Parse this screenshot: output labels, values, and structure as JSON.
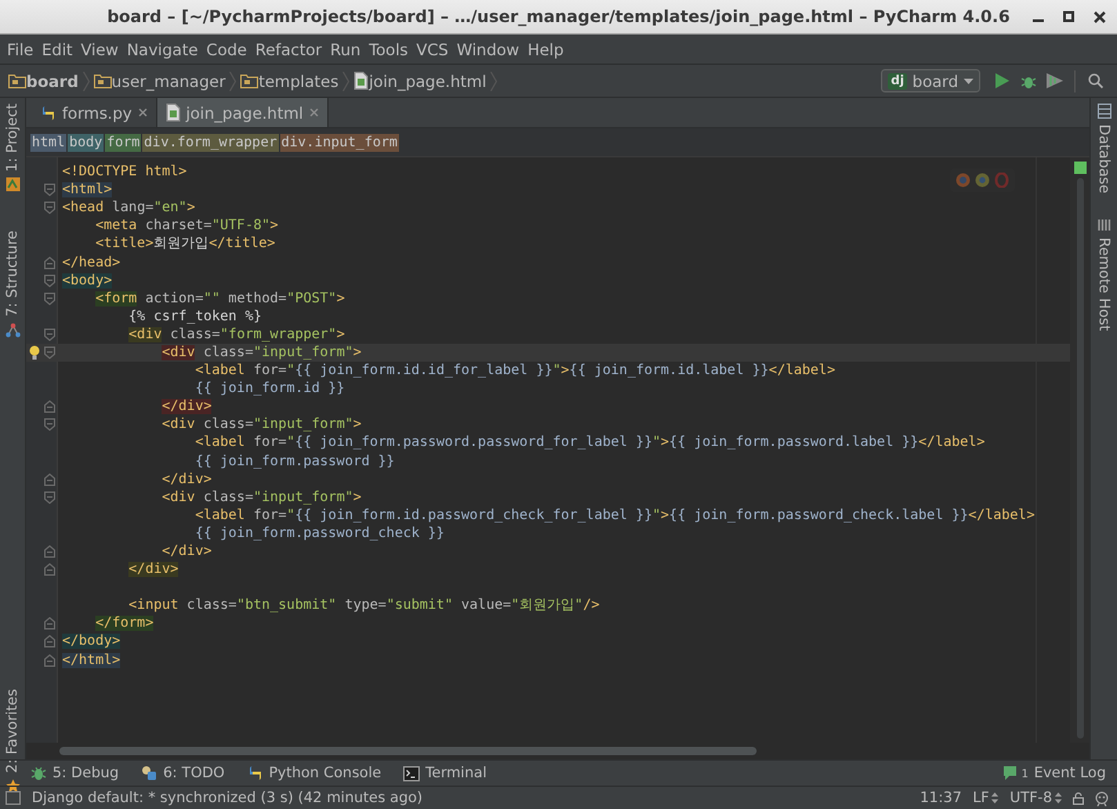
{
  "window": {
    "title": "board – [~/PycharmProjects/board] – …/user_manager/templates/join_page.html – PyCharm 4.0.6"
  },
  "menu": [
    "File",
    "Edit",
    "View",
    "Navigate",
    "Code",
    "Refactor",
    "Run",
    "Tools",
    "VCS",
    "Window",
    "Help"
  ],
  "nav": {
    "crumbs": [
      {
        "label": "board",
        "kind": "project"
      },
      {
        "label": "user_manager",
        "kind": "folder"
      },
      {
        "label": "templates",
        "kind": "folder"
      },
      {
        "label": "join_page.html",
        "kind": "file"
      }
    ],
    "run_config": {
      "badge": "dj",
      "label": "board"
    }
  },
  "left_tools": [
    {
      "label": "1: Project",
      "kind": "project"
    },
    {
      "label": "7: Structure",
      "kind": "structure"
    },
    {
      "label": "2: Favorites",
      "kind": "favorites"
    }
  ],
  "right_tools": [
    {
      "label": "Database",
      "kind": "database"
    },
    {
      "label": "Remote Host",
      "kind": "remote"
    }
  ],
  "tabs": [
    {
      "label": "forms.py",
      "kind": "python",
      "selected": false
    },
    {
      "label": "join_page.html",
      "kind": "html",
      "selected": true
    }
  ],
  "tag_path": [
    {
      "label": "html",
      "color": "#4b5a6b"
    },
    {
      "label": "body",
      "color": "#3f6367"
    },
    {
      "label": "form",
      "color": "#456a44"
    },
    {
      "label": "div.form_wrapper",
      "color": "#5d5b3f"
    },
    {
      "label": "div.input_form",
      "color": "#6b4e3b"
    }
  ],
  "code": {
    "lines": [
      {
        "current": false,
        "tokens": [
          {
            "kind": "tag",
            "t": "<!DOCTYPE html>"
          }
        ]
      },
      {
        "kind": "open",
        "current": false,
        "tokens": [
          {
            "kind": "tag",
            "t": "<html>",
            "color": "#2e3b48"
          }
        ]
      },
      {
        "kind": "open",
        "current": false,
        "tokens": [
          {
            "kind": "tag",
            "t": "<head"
          },
          {
            "kind": "attr",
            "t": " lang="
          },
          {
            "kind": "value",
            "t": "\"en\""
          },
          {
            "kind": "tag",
            "t": ">"
          }
        ],
        "children": [
          {
            "current": false,
            "tokens": [
              {
                "kind": "tag",
                "t": "<meta"
              },
              {
                "kind": "attr",
                "t": " charset="
              },
              {
                "kind": "value",
                "t": "\"UTF-8\""
              },
              {
                "kind": "tag",
                "t": ">"
              }
            ]
          },
          {
            "current": false,
            "tokens": [
              {
                "kind": "tag",
                "t": "<title>"
              },
              {
                "kind": "text",
                "t": "회원가입"
              },
              {
                "kind": "tag",
                "t": "</title>"
              }
            ]
          }
        ]
      },
      {
        "kind": "close",
        "current": false,
        "tokens": [
          {
            "kind": "tag",
            "t": "</head>"
          }
        ]
      },
      {
        "kind": "open",
        "current": false,
        "tokens": [
          {
            "kind": "tag",
            "t": "<body>",
            "color": "#1f3a3c"
          }
        ],
        "children": [
          {
            "kind": "open",
            "current": false,
            "tokens": [
              {
                "kind": "tag",
                "t": "<form",
                "color": "#2b3f22"
              },
              {
                "kind": "attr",
                "t": " action="
              },
              {
                "kind": "value",
                "t": "\"\""
              },
              {
                "kind": "attr",
                "t": " method="
              },
              {
                "kind": "value",
                "t": "\"POST\""
              },
              {
                "kind": "tag",
                "t": ">"
              }
            ],
            "children": [
              {
                "current": false,
                "tokens": [
                  {
                    "kind": "text",
                    "t": "{% csrf_token %}"
                  }
                ]
              },
              {
                "kind": "open",
                "current": false,
                "tokens": [
                  {
                    "kind": "tag",
                    "t": "<div",
                    "color": "#3a3a20"
                  },
                  {
                    "kind": "attr",
                    "t": " class="
                  },
                  {
                    "kind": "value",
                    "t": "\"form_wrapper\""
                  },
                  {
                    "kind": "tag",
                    "t": ">"
                  }
                ],
                "children": [
                  {
                    "kind": "open",
                    "current": true,
                    "tokens": [
                      {
                        "kind": "tag",
                        "t": "<div",
                        "color": "#4a2424"
                      },
                      {
                        "kind": "attr",
                        "t": " class="
                      },
                      {
                        "kind": "value",
                        "t": "\"input_form\""
                      },
                      {
                        "kind": "tag",
                        "t": ">"
                      }
                    ],
                    "children": [
                      {
                        "current": false,
                        "tokens": [
                          {
                            "kind": "tag",
                            "t": "<label"
                          },
                          {
                            "kind": "attr",
                            "t": " for="
                          },
                          {
                            "kind": "value",
                            "t": "\""
                          },
                          {
                            "kind": "tpl",
                            "t": "{{ join_form.id.id_for_label }}"
                          },
                          {
                            "kind": "value",
                            "t": "\""
                          },
                          {
                            "kind": "tag",
                            "t": ">"
                          },
                          {
                            "kind": "tpl",
                            "t": "{{ join_form.id.label }}"
                          },
                          {
                            "kind": "tag",
                            "t": "</label>"
                          }
                        ]
                      },
                      {
                        "current": false,
                        "tokens": [
                          {
                            "kind": "tpl",
                            "t": "{{ join_form.id }}"
                          }
                        ]
                      }
                    ]
                  },
                  {
                    "kind": "close",
                    "current": false,
                    "tokens": [
                      {
                        "kind": "tag",
                        "t": "</div>",
                        "color": "#4a2424"
                      }
                    ]
                  },
                  {
                    "kind": "open",
                    "current": false,
                    "tokens": [
                      {
                        "kind": "tag",
                        "t": "<div"
                      },
                      {
                        "kind": "attr",
                        "t": " class="
                      },
                      {
                        "kind": "value",
                        "t": "\"input_form\""
                      },
                      {
                        "kind": "tag",
                        "t": ">"
                      }
                    ],
                    "children": [
                      {
                        "current": false,
                        "tokens": [
                          {
                            "kind": "tag",
                            "t": "<label"
                          },
                          {
                            "kind": "attr",
                            "t": " for="
                          },
                          {
                            "kind": "value",
                            "t": "\""
                          },
                          {
                            "kind": "tpl",
                            "t": "{{ join_form.password.password_for_label }}"
                          },
                          {
                            "kind": "value",
                            "t": "\""
                          },
                          {
                            "kind": "tag",
                            "t": ">"
                          },
                          {
                            "kind": "tpl",
                            "t": "{{ join_form.password.label }}"
                          },
                          {
                            "kind": "tag",
                            "t": "</label>"
                          }
                        ]
                      },
                      {
                        "current": false,
                        "tokens": [
                          {
                            "kind": "tpl",
                            "t": "{{ join_form.password }}"
                          }
                        ]
                      }
                    ]
                  },
                  {
                    "kind": "close",
                    "current": false,
                    "tokens": [
                      {
                        "kind": "tag",
                        "t": "</div>"
                      }
                    ]
                  },
                  {
                    "kind": "open",
                    "current": false,
                    "tokens": [
                      {
                        "kind": "tag",
                        "t": "<div"
                      },
                      {
                        "kind": "attr",
                        "t": " class="
                      },
                      {
                        "kind": "value",
                        "t": "\"input_form\""
                      },
                      {
                        "kind": "tag",
                        "t": ">"
                      }
                    ],
                    "children": [
                      {
                        "current": false,
                        "tokens": [
                          {
                            "kind": "tag",
                            "t": "<label"
                          },
                          {
                            "kind": "attr",
                            "t": " for="
                          },
                          {
                            "kind": "value",
                            "t": "\""
                          },
                          {
                            "kind": "tpl",
                            "t": "{{ join_form.id.password_check_for_label }}"
                          },
                          {
                            "kind": "value",
                            "t": "\""
                          },
                          {
                            "kind": "tag",
                            "t": ">"
                          },
                          {
                            "kind": "tpl",
                            "t": "{{ join_form.password_check.label }}"
                          },
                          {
                            "kind": "tag",
                            "t": "</label>"
                          }
                        ]
                      },
                      {
                        "current": false,
                        "tokens": [
                          {
                            "kind": "tpl",
                            "t": "{{ join_form.password_check }}"
                          }
                        ]
                      }
                    ]
                  },
                  {
                    "kind": "close",
                    "current": false,
                    "tokens": [
                      {
                        "kind": "tag",
                        "t": "</div>"
                      }
                    ]
                  }
                ]
              },
              {
                "kind": "close",
                "current": false,
                "tokens": [
                  {
                    "kind": "tag",
                    "t": "</div>",
                    "color": "#3a3a20"
                  }
                ]
              },
              {
                "current": false
              },
              {
                "current": false,
                "tokens": [
                  {
                    "kind": "tag",
                    "t": "<input"
                  },
                  {
                    "kind": "attr",
                    "t": " class="
                  },
                  {
                    "kind": "value",
                    "t": "\"btn_submit\""
                  },
                  {
                    "kind": "attr",
                    "t": " type="
                  },
                  {
                    "kind": "value",
                    "t": "\"submit\""
                  },
                  {
                    "kind": "attr",
                    "t": " value="
                  },
                  {
                    "kind": "value",
                    "t": "\"회원가입\""
                  },
                  {
                    "kind": "tag",
                    "t": "/>"
                  }
                ]
              }
            ]
          },
          {
            "kind": "close",
            "current": false,
            "tokens": [
              {
                "kind": "tag",
                "t": "</form>",
                "color": "#2b3f22"
              }
            ]
          }
        ]
      },
      {
        "kind": "close",
        "current": false,
        "tokens": [
          {
            "kind": "tag",
            "t": "</body>",
            "color": "#1f3a3c"
          }
        ]
      },
      {
        "kind": "close",
        "current": false,
        "tokens": [
          {
            "kind": "tag",
            "t": "</html>",
            "color": "#2e3b48"
          }
        ]
      }
    ]
  },
  "tool_buttons": [
    {
      "label": "5: Debug",
      "kind": "debug"
    },
    {
      "label": "6: TODO",
      "kind": "todo"
    },
    {
      "label": "Python Console",
      "kind": "python"
    },
    {
      "label": "Terminal",
      "kind": "terminal"
    }
  ],
  "event_log": {
    "count": "1",
    "label": "Event Log"
  },
  "status": {
    "message": "Django default: * synchronized (3 s) (42 minutes ago)",
    "position": "11:37",
    "line_separator": "LF",
    "encoding": "UTF-8"
  }
}
